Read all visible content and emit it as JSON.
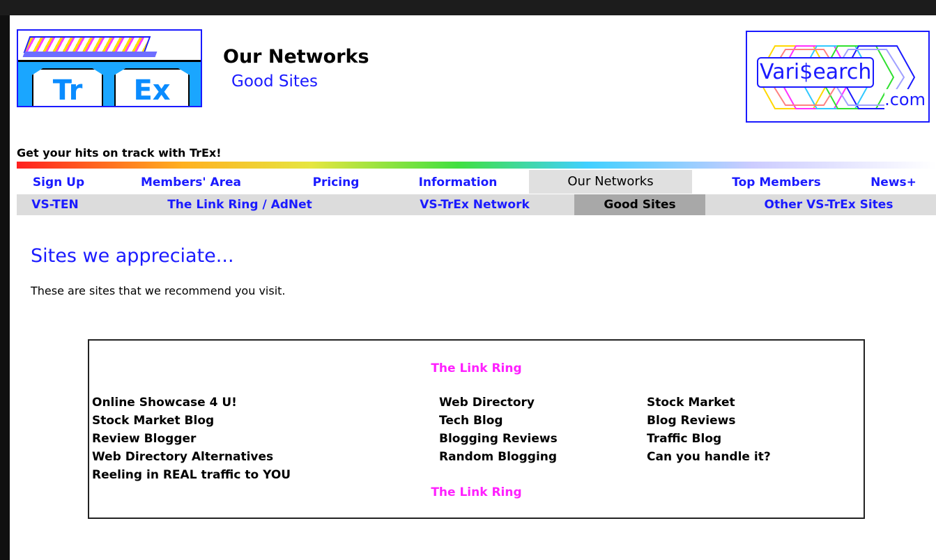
{
  "header": {
    "trex_logo": {
      "left_letters": "Tr",
      "right_letters": "Ex",
      "icon": "trex-train-logo"
    },
    "title": "Our Networks",
    "subtitle": "Good Sites",
    "varisearch_logo": {
      "main_text": "Vari$earch",
      "suffix": ".com",
      "icon": "varisearch-logo"
    },
    "tagline": "Get your hits on track with TrEx!"
  },
  "nav_primary": {
    "items": [
      {
        "label": "Sign Up"
      },
      {
        "label": "Members' Area"
      },
      {
        "label": "Pricing"
      },
      {
        "label": "Information"
      },
      {
        "label": "Our Networks",
        "active": true
      },
      {
        "label": "Top Members"
      },
      {
        "label": "News+"
      }
    ]
  },
  "nav_secondary": {
    "items": [
      {
        "label": "VS-TEN"
      },
      {
        "label": "The Link Ring / AdNet"
      },
      {
        "label": "VS-TrEx Network"
      },
      {
        "label": "Good Sites",
        "active": true
      },
      {
        "label": "Other VS-TrEx Sites"
      }
    ]
  },
  "main": {
    "heading": "Sites we appreciate...",
    "intro": "These are sites that we recommend you visit."
  },
  "link_ring": {
    "title_top": "The Link Ring",
    "title_bottom": "The Link Ring",
    "columns": [
      [
        "Online Showcase 4 U!",
        "Stock Market Blog",
        "Review Blogger",
        "Web Directory Alternatives",
        "Reeling in REAL traffic to YOU"
      ],
      [
        "Web Directory",
        "Tech Blog",
        "Blogging Reviews",
        "Random Blogging"
      ],
      [
        "Stock Market",
        "Blog Reviews",
        "Traffic Blog",
        "Can you handle it?"
      ]
    ]
  },
  "colors": {
    "link_blue": "#1a1aff",
    "ring_magenta": "#ff20ff",
    "nav_active_bg": "#e0e0e0",
    "subnav_bg": "#dcdcdc",
    "subnav_active_bg": "#a8a8a8"
  }
}
